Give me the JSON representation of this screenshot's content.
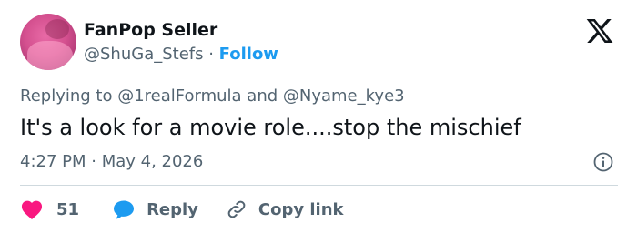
{
  "author": {
    "display_name": "FanPop Seller",
    "handle": "@ShuGa_Stefs",
    "separator": " · ",
    "follow_label": "Follow",
    "avatar_icon": "profile-avatar"
  },
  "brand": {
    "logo_icon": "x-logo-icon",
    "logo_color": "#0f1419"
  },
  "reply_context": {
    "prefix": "Replying to ",
    "mention_1": "@1realFormula",
    "conjunction": " and ",
    "mention_2": "@Nyame_kye3"
  },
  "tweet": {
    "text": "It's a look for a movie role....stop the mischief",
    "timestamp": "4:27 PM · May 4, 2026"
  },
  "actions": {
    "like_count": "51",
    "like_icon": "heart-icon",
    "like_color": "#f91880",
    "reply_label": "Reply",
    "reply_icon": "speech-bubble-icon",
    "reply_color": "#1d9bf0",
    "copy_label": "Copy link",
    "copy_icon": "link-icon"
  },
  "colors": {
    "text_primary": "#0f1419",
    "text_secondary": "#536471",
    "accent": "#1d9bf0",
    "divider": "#cfd9de"
  }
}
